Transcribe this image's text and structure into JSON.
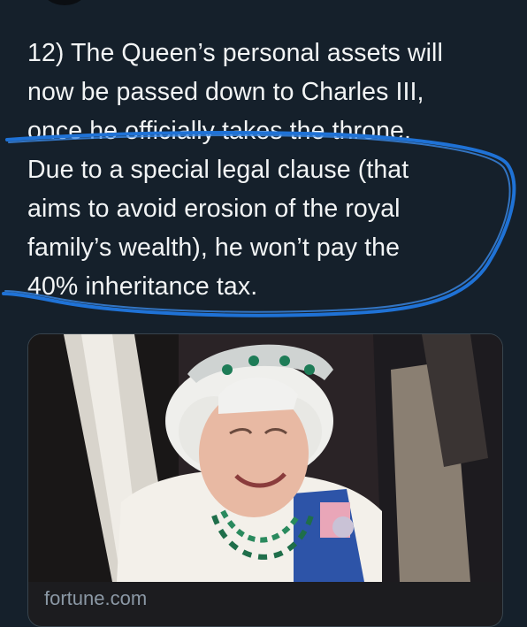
{
  "tweet": {
    "paragraph_1": "12) The Queen’s personal assets will\nnow be passed down to Charles III,\nonce he officially takes the throne.",
    "paragraph_2": "Due to a special legal clause (that\naims to avoid erosion of the royal\nfamily’s wealth), he won’t pay the\n40% inheritance tax."
  },
  "card": {
    "image": "photo-queen-elizabeth-smiling",
    "source": "fortune.com"
  },
  "colors": {
    "background": "#15202b",
    "text": "#f2f4f5",
    "highlight_scribble": "#1f72d6",
    "card_border": "#38444d"
  }
}
